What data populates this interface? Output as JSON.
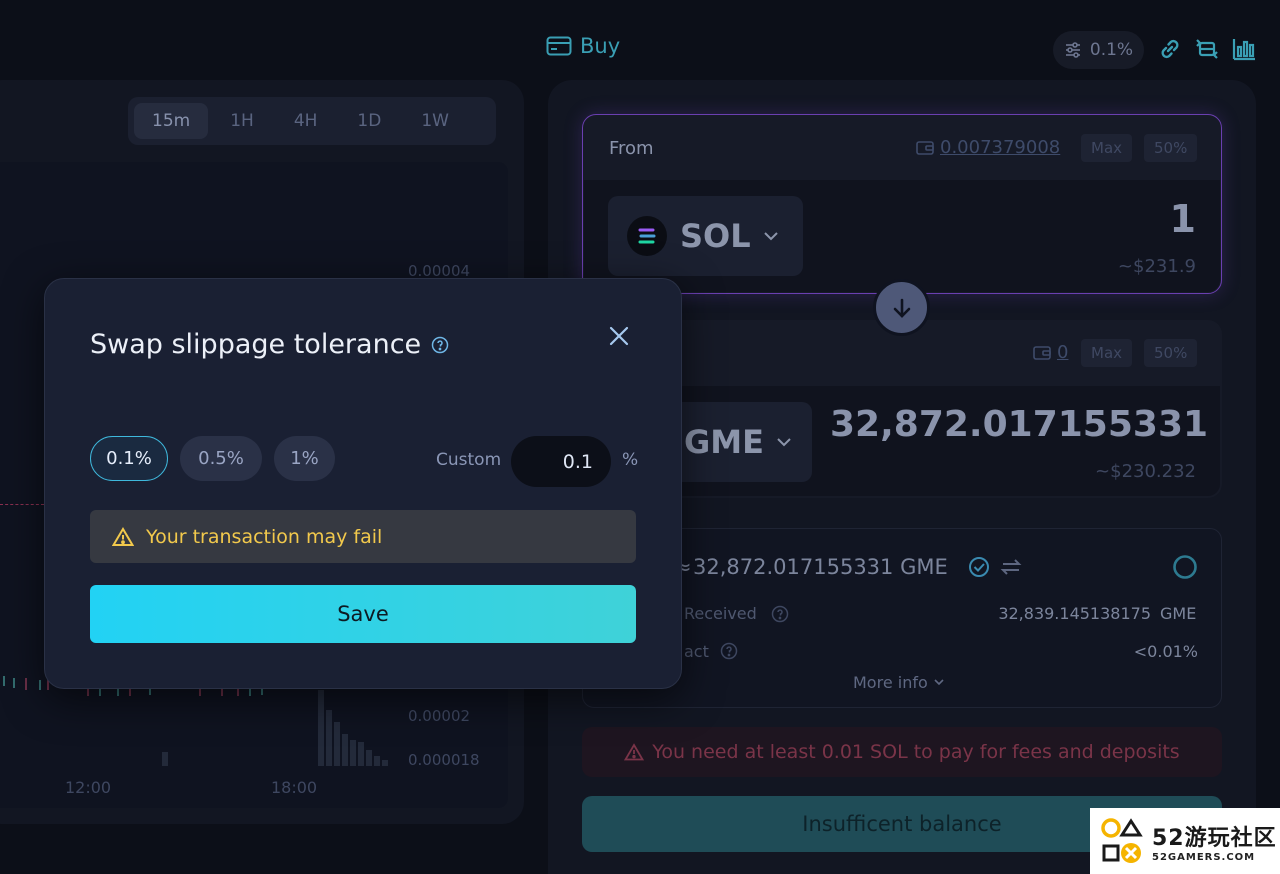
{
  "header": {
    "buy_label": "Buy",
    "slippage_value": "0.1%"
  },
  "chart": {
    "timeframes": [
      {
        "label": "15m",
        "active": true
      },
      {
        "label": "1H",
        "active": false
      },
      {
        "label": "4H",
        "active": false
      },
      {
        "label": "1D",
        "active": false
      },
      {
        "label": "1W",
        "active": false
      }
    ],
    "y_ticks": [
      "0.00004",
      "0.00002",
      "0.000018"
    ],
    "x_ticks": [
      "12:00",
      "18:00"
    ]
  },
  "swap": {
    "from": {
      "label": "From",
      "balance": "0.007379008",
      "max_label": "Max",
      "half_label": "50%",
      "token": "SOL",
      "amount": "1",
      "usd": "~$231.9"
    },
    "to": {
      "balance": "0",
      "max_label": "Max",
      "half_label": "50%",
      "token": "GME",
      "amount": "32,872.017155331",
      "usd": "~$230.232"
    },
    "rate": {
      "text": "32,872.017155331 GME",
      "prefix": "≈",
      "min_received_label": "Received",
      "min_received_value": "32,839.145138175",
      "min_received_unit": "GME",
      "impact_label": "act",
      "impact_value": "<0.01%",
      "more_info": "More info"
    },
    "fee_warning": "You need at least 0.01 SOL to pay for fees and deposits",
    "submit_label": "Insufficent balance"
  },
  "modal": {
    "title": "Swap slippage tolerance",
    "presets": [
      {
        "label": "0.1%",
        "selected": true
      },
      {
        "label": "0.5%",
        "selected": false
      },
      {
        "label": "1%",
        "selected": false
      }
    ],
    "custom_label": "Custom",
    "custom_value": "0.1",
    "percent_sign": "%",
    "warning": "Your transaction may fail",
    "save_label": "Save"
  },
  "watermark": {
    "brand": "52游玩社区",
    "domain": "52GAMERS.COM"
  },
  "colors": {
    "accent_cyan": "#22d2f4",
    "warning_yellow": "#f2c94c",
    "error_red": "#7a3448",
    "from_border": "#6a3fb0"
  }
}
